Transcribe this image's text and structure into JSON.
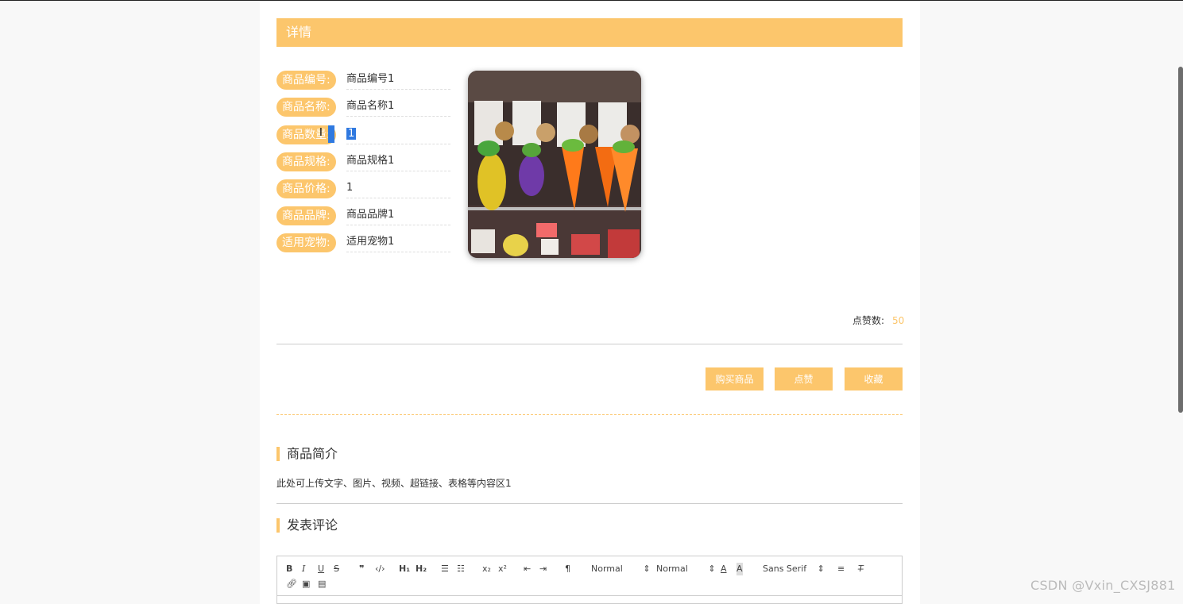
{
  "header": {
    "title": "详情"
  },
  "fields": [
    {
      "label": "商品编号:",
      "value": "商品编号1"
    },
    {
      "label": "商品名称:",
      "value": "商品名称1"
    },
    {
      "label": "商品数量:",
      "value": "1"
    },
    {
      "label": "商品规格:",
      "value": "商品规格1"
    },
    {
      "label": "商品价格:",
      "value": "1"
    },
    {
      "label": "商品品牌:",
      "value": "商品品牌1"
    },
    {
      "label": "适用宠物:",
      "value": "适用宠物1"
    }
  ],
  "likes": {
    "label": "点赞数:",
    "count": "50"
  },
  "actions": {
    "buy": "购买商品",
    "like": "点赞",
    "favorite": "收藏"
  },
  "intro": {
    "title": "商品简介",
    "text": "此处可上传文字、图片、视频、超链接、表格等内容区1"
  },
  "comment": {
    "title": "发表评论"
  },
  "editor": {
    "header_select": "Normal",
    "size_select": "Normal",
    "font_select": "Sans Serif",
    "subscript": "x₂",
    "superscript": "x²",
    "h1": "H₁",
    "h2": "H₂"
  },
  "watermark": "CSDN @Vxin_CXSJ881",
  "colors": {
    "accent": "#fcc66c",
    "selection": "#2f79e0"
  }
}
